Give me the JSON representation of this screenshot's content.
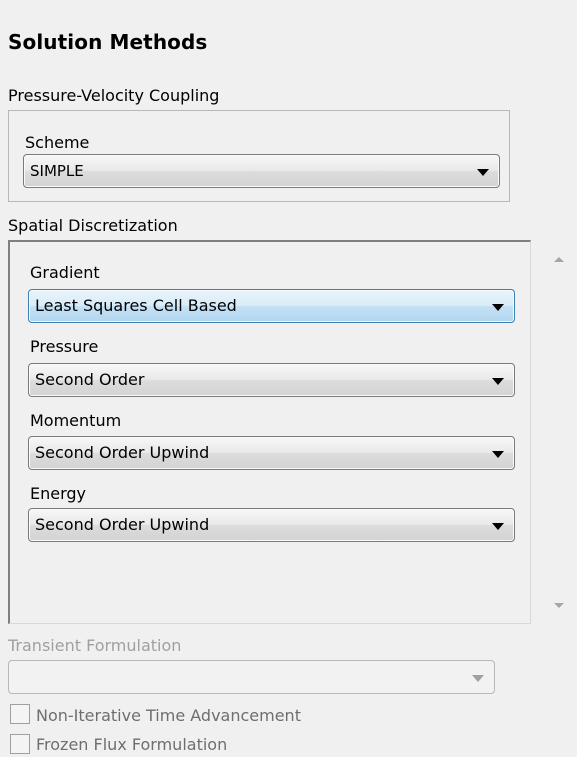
{
  "panel": {
    "title": "Solution Methods"
  },
  "pressure_velocity": {
    "group_label": "Pressure-Velocity Coupling",
    "scheme_label": "Scheme",
    "scheme_value": "SIMPLE"
  },
  "spatial": {
    "group_label": "Spatial Discretization",
    "fields": [
      {
        "label": "Gradient",
        "value": "Least Squares Cell Based"
      },
      {
        "label": "Pressure",
        "value": "Second Order"
      },
      {
        "label": "Momentum",
        "value": "Second Order Upwind"
      },
      {
        "label": "Energy",
        "value": "Second Order Upwind"
      }
    ]
  },
  "transient": {
    "label": "Transient Formulation",
    "value": ""
  },
  "options": [
    {
      "label": "Non-Iterative Time Advancement",
      "checked": false
    },
    {
      "label": "Frozen Flux Formulation",
      "checked": false
    }
  ]
}
